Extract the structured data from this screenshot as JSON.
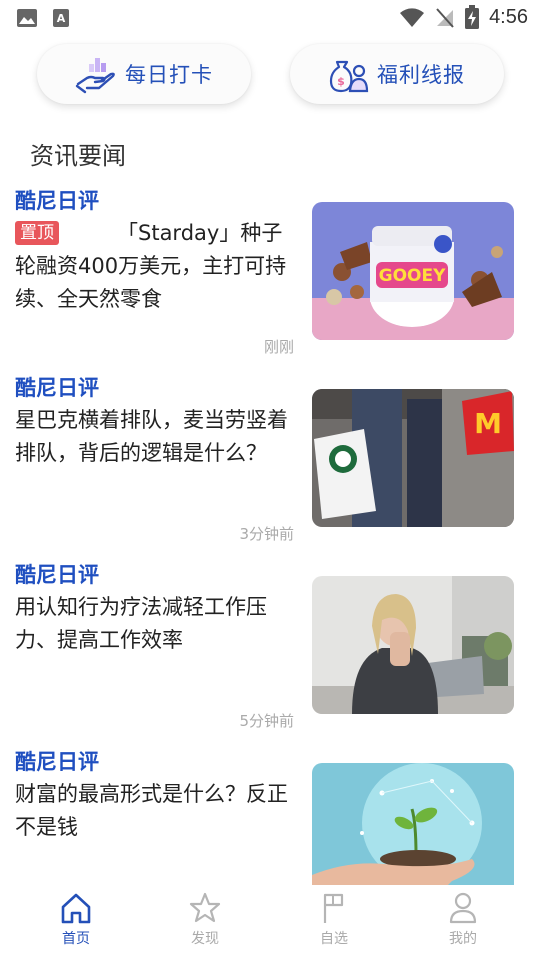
{
  "status_bar": {
    "time": "4:56"
  },
  "quick_actions": [
    {
      "label": "每日打卡",
      "icon": "hand-coin-chart-icon"
    },
    {
      "label": "福利线报",
      "icon": "money-bag-person-icon"
    }
  ],
  "section_title": "资讯要闻",
  "pin_label": "置顶",
  "news": [
    {
      "source": "酷尼日评",
      "title": "「Starday」种子轮融资400万美元，主打可持续、全天然零食",
      "time": "刚刚",
      "pinned": true,
      "image": "gooey-snack-jar"
    },
    {
      "source": "酷尼日评",
      "title": "星巴克横着排队，麦当劳竖着排队，背后的逻辑是什么？",
      "time": "3分钟前",
      "pinned": false,
      "image": "starbucks-mcdonalds-bags"
    },
    {
      "source": "酷尼日评",
      "title": "用认知行为疗法减轻工作压力、提高工作效率",
      "time": "5分钟前",
      "pinned": false,
      "image": "stressed-woman-laptop"
    },
    {
      "source": "酷尼日评",
      "title": "财富的最高形式是什么？反正不是钱",
      "time": "",
      "pinned": false,
      "image": "hands-holding-sprout"
    }
  ],
  "tabs": [
    {
      "label": "首页",
      "icon": "home-icon",
      "active": true
    },
    {
      "label": "发现",
      "icon": "star-icon",
      "active": false
    },
    {
      "label": "自选",
      "icon": "flag-icon",
      "active": false
    },
    {
      "label": "我的",
      "icon": "person-icon",
      "active": false
    }
  ],
  "colors": {
    "accent": "#2450b8",
    "pin": "#e8565b"
  }
}
